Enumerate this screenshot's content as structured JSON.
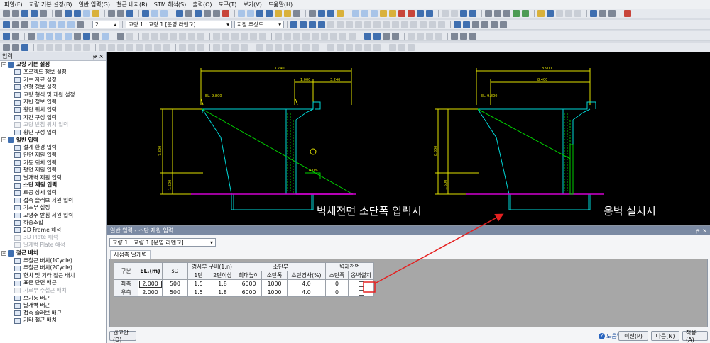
{
  "menu": [
    "파일(F)",
    "교량 기본 설정(B)",
    "일반 입력(G)",
    "철근 배치(R)",
    "STM 해석(S)",
    "출력(O)",
    "도구(T)",
    "보기(V)",
    "도움말(H)"
  ],
  "toolbar": {
    "number_field": "2",
    "bridge_select": "교량 1 : 교량 1 [운영 라멘교]",
    "view_select": "지질 주상도"
  },
  "left_panel": {
    "title": "입력",
    "pin": "ᵽ",
    "close": "×",
    "groups": [
      {
        "label": "교량 기본 설정",
        "items": [
          {
            "label": "프로젝트 정보 설정",
            "state": "normal"
          },
          {
            "label": "기초 자료 설정",
            "state": "normal"
          },
          {
            "label": "선형 정보 설정",
            "state": "normal"
          },
          {
            "label": "교량 형식 및 제원 설정",
            "state": "normal"
          },
          {
            "label": "지반 정보 입력",
            "state": "normal"
          },
          {
            "label": "횡단 위치 입력",
            "state": "normal"
          },
          {
            "label": "지간 구성 입력",
            "state": "normal"
          },
          {
            "label": "교량 받침 위치 입력",
            "state": "disabled"
          },
          {
            "label": "횡단 구성 입력",
            "state": "normal"
          }
        ]
      },
      {
        "label": "일반 입력",
        "items": [
          {
            "label": "설계 환경 입력",
            "state": "normal"
          },
          {
            "label": "단면 제원 입력",
            "state": "normal"
          },
          {
            "label": "기둥 위치 입력",
            "state": "normal"
          },
          {
            "label": "평면 제원 입력",
            "state": "normal"
          },
          {
            "label": "날개벽 제원 입력",
            "state": "normal"
          },
          {
            "label": "소단 제원 입력",
            "state": "selected"
          },
          {
            "label": "토공 상세 입력",
            "state": "normal"
          },
          {
            "label": "접속 슬래브 제원 입력",
            "state": "normal"
          },
          {
            "label": "기초부 설정",
            "state": "normal"
          },
          {
            "label": "교명주 받침 제원 입력",
            "state": "normal"
          },
          {
            "label": "하중조합",
            "state": "normal"
          },
          {
            "label": "2D Frame 해석",
            "state": "normal"
          },
          {
            "label": "3D Plate 해석",
            "state": "disabled"
          },
          {
            "label": "날개벽 Plate 해석",
            "state": "disabled"
          }
        ]
      },
      {
        "label": "철근 배치",
        "items": [
          {
            "label": "주철근 배치(1Cycle)",
            "state": "normal"
          },
          {
            "label": "주철근 배치(2Cycle)",
            "state": "normal"
          },
          {
            "label": "헌치 및 기타 철근 배치",
            "state": "normal"
          },
          {
            "label": "표준 단면 배근",
            "state": "normal"
          },
          {
            "label": "가로부 주철근 배치",
            "state": "disabled"
          },
          {
            "label": "보기둥 배근",
            "state": "normal"
          },
          {
            "label": "날개벽 배근",
            "state": "normal"
          },
          {
            "label": "접속 슬래브 배근",
            "state": "normal"
          },
          {
            "label": "기타 철근 배치",
            "state": "normal"
          }
        ]
      }
    ]
  },
  "cad": {
    "caption_left": "벽체전면 소단폭 입력시",
    "caption_right": "옹벽 설치시",
    "left_dims": {
      "top_total": "13.740",
      "d1": "1.000",
      "d2": "3.240",
      "el_top": "EL. 9.800",
      "h_total": "7.800",
      "h_low": "1.600",
      "slope": "4.0%"
    },
    "right_dims": {
      "top_total": "8.900",
      "d1": "8.400",
      "el_top": "EL. 9.800",
      "h_total": "8.800",
      "h_low": "1.600"
    }
  },
  "bottom_panel": {
    "title": "일반 입력 - 소단 제원 입력",
    "pin": "ᵽ",
    "close": "×",
    "bridge_select": "교량 1 : 교량 1 [운영 라멘교]",
    "tab": "시점측 날개벽",
    "table": {
      "h_gubun": "구분",
      "h_el": "EL.(m)",
      "h_sd": "sD",
      "h_slope_group": "경사부 구배(1:n)",
      "h_slope_1": "1단",
      "h_slope_2": "2단이상",
      "h_sodan_group": "소단부",
      "h_max_h": "최대높이",
      "h_width": "소단폭",
      "h_grad": "소단경사(%)",
      "h_front_group": "벽체전면",
      "h_front_width": "소단폭",
      "h_wall": "옹벽설치",
      "rows": [
        {
          "side": "좌측",
          "el": "2.000",
          "sd": "500",
          "s1": "1.5",
          "s2": "1.8",
          "max_h": "6000",
          "width": "1000",
          "grad": "4.0",
          "front": "0",
          "wall": false
        },
        {
          "side": "우측",
          "el": "2.000",
          "sd": "500",
          "s1": "1.5",
          "s2": "1.8",
          "max_h": "6000",
          "width": "1000",
          "grad": "4.0",
          "front": "0",
          "wall": false
        }
      ]
    },
    "buttons": {
      "recommend": "권고안(D)",
      "help": "도움말",
      "prev": "이전(P)",
      "next": "다음(N)",
      "apply": "적용(A)"
    }
  }
}
